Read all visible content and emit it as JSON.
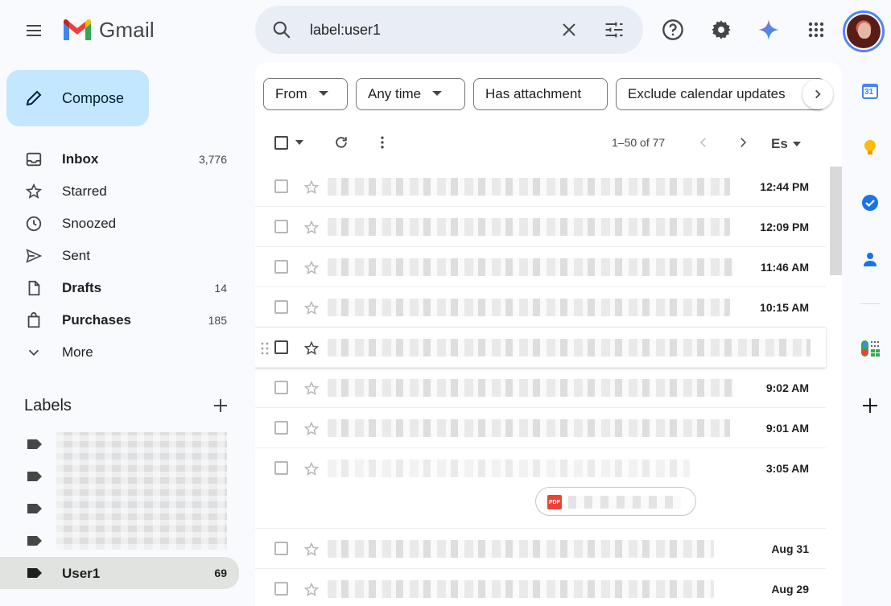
{
  "app": {
    "name": "Gmail"
  },
  "search": {
    "value": "label:user1"
  },
  "compose": {
    "label": "Compose"
  },
  "nav": {
    "items": [
      {
        "label": "Inbox",
        "count": "3,776",
        "bold": true,
        "icon": "inbox-icon"
      },
      {
        "label": "Starred",
        "count": "",
        "bold": false,
        "icon": "star-icon"
      },
      {
        "label": "Snoozed",
        "count": "",
        "bold": false,
        "icon": "clock-icon"
      },
      {
        "label": "Sent",
        "count": "",
        "bold": false,
        "icon": "send-icon"
      },
      {
        "label": "Drafts",
        "count": "14",
        "bold": true,
        "icon": "draft-icon"
      },
      {
        "label": "Purchases",
        "count": "185",
        "bold": true,
        "icon": "shopping-bag-icon"
      },
      {
        "label": "More",
        "count": "",
        "bold": false,
        "icon": "chevron-down-icon"
      }
    ]
  },
  "labels": {
    "title": "Labels",
    "selected": {
      "label": "User1",
      "count": "69"
    }
  },
  "filters": {
    "chips": [
      "From",
      "Any time",
      "Has attachment",
      "Exclude calendar updates"
    ]
  },
  "toolbar": {
    "pagination": "1–50 of 77",
    "lang": "Es"
  },
  "emails": [
    {
      "time": "12:44 PM"
    },
    {
      "time": "12:09 PM"
    },
    {
      "time": "11:46 AM"
    },
    {
      "time": "10:15 AM"
    },
    {
      "time": ""
    },
    {
      "time": "9:02 AM"
    },
    {
      "time": "9:01 AM"
    },
    {
      "time": "3:05 AM",
      "attachment": "PDF"
    },
    {
      "time": "Aug 31"
    },
    {
      "time": "Aug 29"
    }
  ],
  "rail": {
    "calendar_day": "31"
  },
  "colors": {
    "compose_bg": "#c2e7ff",
    "search_bg": "#e9eef6",
    "selected_label_bg": "#e1e3e1",
    "pdf_red": "#ea4335"
  }
}
